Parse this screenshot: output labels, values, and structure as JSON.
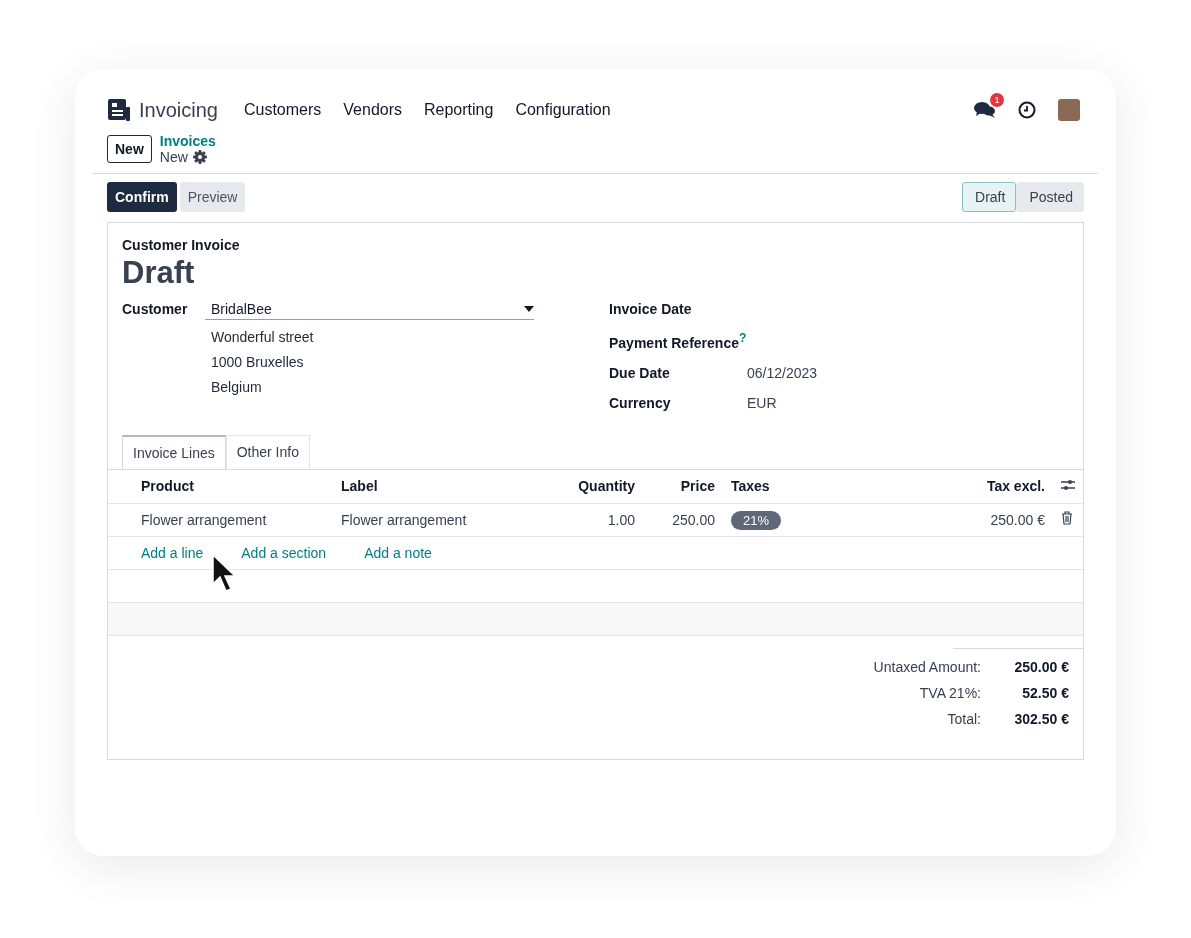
{
  "app": {
    "name": "Invoicing"
  },
  "menu": [
    "Customers",
    "Vendors",
    "Reporting",
    "Configuration"
  ],
  "notifications": {
    "count": "1"
  },
  "control_panel": {
    "new_button": "New",
    "breadcrumb_parent": "Invoices",
    "breadcrumb_current": "New"
  },
  "actions": [
    {
      "label": "Confirm",
      "kind": "primary"
    },
    {
      "label": "Preview",
      "kind": "secondary"
    }
  ],
  "status_steps": [
    {
      "label": "Draft",
      "selected": true
    },
    {
      "label": "Posted",
      "selected": false
    }
  ],
  "form": {
    "type_label": "Customer Invoice",
    "title": "Draft",
    "customer": {
      "label": "Customer",
      "value": "BridalBee",
      "address": [
        "Wonderful street",
        "1000 Bruxelles",
        "Belgium"
      ]
    },
    "right_fields": [
      {
        "label": "Invoice Date"
      },
      {
        "label": "Payment Reference",
        "help": "?"
      },
      {
        "label": "Due Date",
        "value": "06/12/2023"
      },
      {
        "label": "Currency",
        "value": "EUR"
      }
    ]
  },
  "tabs": [
    {
      "label": "Invoice Lines",
      "selected": true
    },
    {
      "label": "Other Info",
      "selected": false
    }
  ],
  "table": {
    "columns": [
      "Product",
      "Label",
      "Quantity",
      "Price",
      "Taxes",
      "Tax excl."
    ],
    "rows": [
      {
        "product": "Flower arrangement",
        "label": "Flower arrangement",
        "quantity": "1.00",
        "price": "250.00",
        "tax": "21%",
        "subtotal": "250.00 €"
      }
    ],
    "add_links": [
      "Add a line",
      "Add a section",
      "Add a note"
    ]
  },
  "totals": [
    {
      "label": "Untaxed Amount:",
      "value": "250.00 €"
    },
    {
      "label": "TVA 21%:",
      "value": "52.50 €"
    },
    {
      "label": "Total:",
      "value": "302.50 €"
    }
  ]
}
